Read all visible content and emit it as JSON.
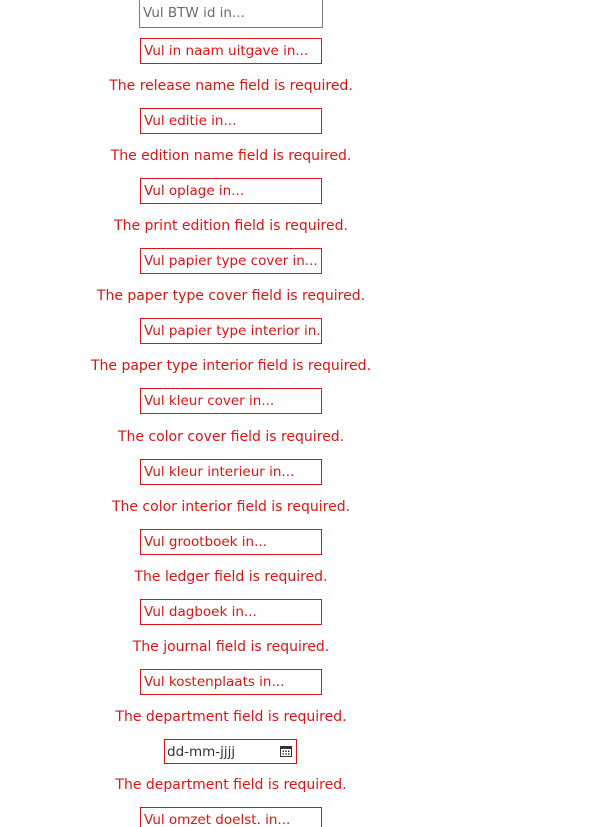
{
  "vat": {
    "placeholder": "Vul BTW id in..."
  },
  "fields": [
    {
      "placeholder": "Vul in naam uitgave in...",
      "error": "The release name field is required."
    },
    {
      "placeholder": "Vul editie in...",
      "error": "The edition name field is required."
    },
    {
      "placeholder": "Vul oplage in...",
      "error": "The print edition field is required."
    },
    {
      "placeholder": "Vul papier type cover in...",
      "error": "The paper type cover field is required."
    },
    {
      "placeholder": "Vul papier type interior in...",
      "error": "The paper type interior field is required."
    },
    {
      "placeholder": "Vul kleur cover in...",
      "error": "The color cover field is required."
    },
    {
      "placeholder": "Vul kleur interieur in...",
      "error": "The color interior field is required."
    },
    {
      "placeholder": "Vul grootboek in...",
      "error": "The ledger field is required."
    },
    {
      "placeholder": "Vul dagboek in...",
      "error": "The journal field is required."
    },
    {
      "placeholder": "Vul kostenplaats in...",
      "error": "The department field is required."
    }
  ],
  "date": {
    "placeholder": "dd-mm-jjjj",
    "icon": "calendar-icon",
    "error": "The department field is required."
  },
  "last_field": {
    "placeholder": "Vul omzet doelst. in..."
  },
  "colors": {
    "error": "#dc1414",
    "normal_border": "#7a7a7a"
  }
}
